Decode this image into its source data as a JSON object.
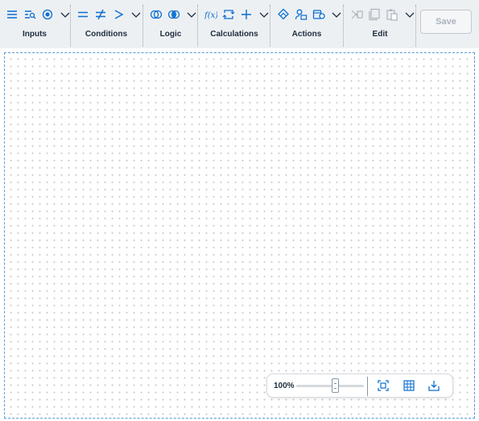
{
  "toolbar": {
    "groups": [
      {
        "label": "Inputs"
      },
      {
        "label": "Conditions"
      },
      {
        "label": "Logic"
      },
      {
        "label": "Calculations"
      },
      {
        "label": "Actions"
      },
      {
        "label": "Edit"
      }
    ],
    "save_label": "Save"
  },
  "zoom": {
    "level_label": "100%",
    "slider_fraction": 0.5
  },
  "colors": {
    "accent": "#0a6ed1",
    "disabled": "#aab3bc",
    "toolbar_bg": "#edf0f3",
    "canvas_border": "#5b9bd5"
  }
}
